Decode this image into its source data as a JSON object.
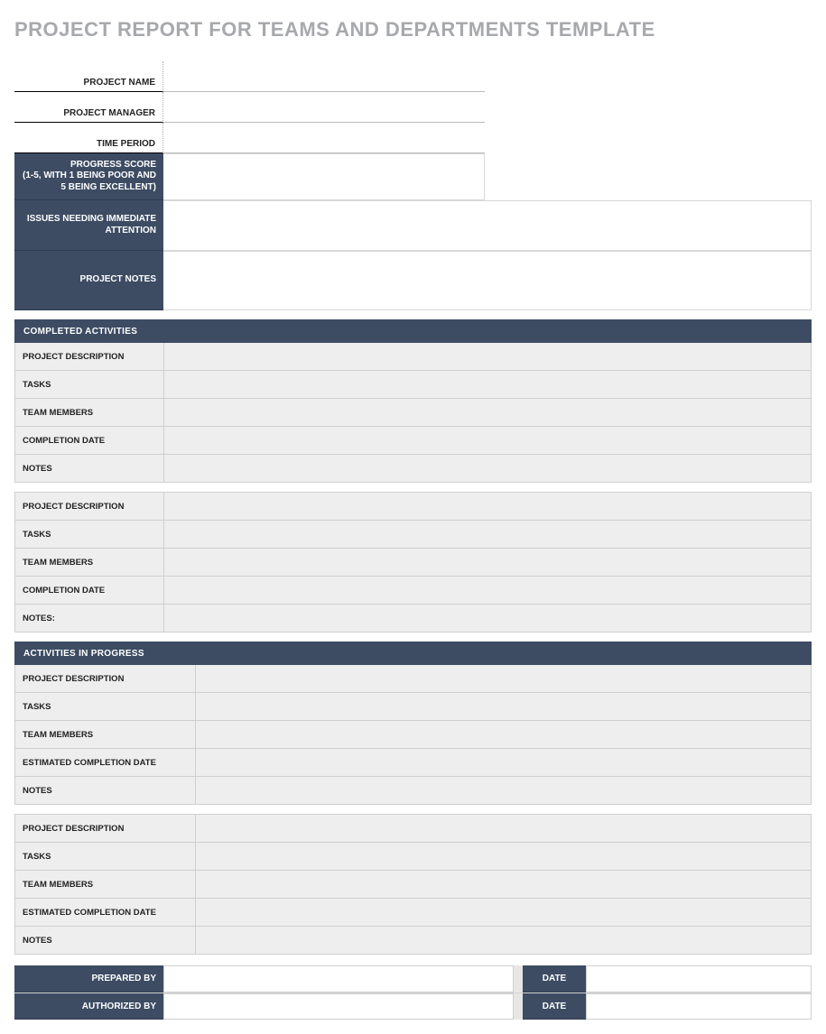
{
  "title": "PROJECT REPORT FOR TEAMS AND DEPARTMENTS TEMPLATE",
  "meta": {
    "project_name_label": "PROJECT NAME",
    "project_name_value": "",
    "project_manager_label": "PROJECT MANAGER",
    "project_manager_value": "",
    "time_period_label": "TIME PERIOD",
    "time_period_value": ""
  },
  "overview": {
    "progress_score_label": "PROGRESS SCORE\n(1-5, WITH 1 BEING POOR AND 5 BEING EXCELLENT)",
    "progress_score_value": "",
    "issues_label": "ISSUES NEEDING IMMEDIATE ATTENTION",
    "issues_value": "",
    "notes_label": "PROJECT NOTES",
    "notes_value": ""
  },
  "completed": {
    "header": "COMPLETED ACTIVITIES",
    "groups": [
      {
        "rows": [
          {
            "label": "PROJECT DESCRIPTION",
            "value": ""
          },
          {
            "label": "TASKS",
            "value": ""
          },
          {
            "label": "TEAM MEMBERS",
            "value": ""
          },
          {
            "label": "COMPLETION DATE",
            "value": ""
          },
          {
            "label": "NOTES",
            "value": ""
          }
        ]
      },
      {
        "rows": [
          {
            "label": "PROJECT DESCRIPTION",
            "value": ""
          },
          {
            "label": "TASKS",
            "value": ""
          },
          {
            "label": "TEAM MEMBERS",
            "value": ""
          },
          {
            "label": "COMPLETION DATE",
            "value": ""
          },
          {
            "label": "NOTES:",
            "value": ""
          }
        ]
      }
    ]
  },
  "in_progress": {
    "header": "ACTIVITIES IN PROGRESS",
    "groups": [
      {
        "rows": [
          {
            "label": "PROJECT DESCRIPTION",
            "value": ""
          },
          {
            "label": "TASKS",
            "value": ""
          },
          {
            "label": "TEAM MEMBERS",
            "value": ""
          },
          {
            "label": "ESTIMATED COMPLETION DATE",
            "value": ""
          },
          {
            "label": "NOTES",
            "value": ""
          }
        ]
      },
      {
        "rows": [
          {
            "label": "PROJECT DESCRIPTION",
            "value": ""
          },
          {
            "label": "TASKS",
            "value": ""
          },
          {
            "label": "TEAM MEMBERS",
            "value": ""
          },
          {
            "label": "ESTIMATED COMPLETION DATE",
            "value": ""
          },
          {
            "label": "NOTES",
            "value": ""
          }
        ]
      }
    ]
  },
  "footer": {
    "prepared_by_label": "PREPARED BY",
    "prepared_by_value": "",
    "prepared_date_label": "DATE",
    "prepared_date_value": "",
    "authorized_by_label": "AUTHORIZED BY",
    "authorized_by_value": "",
    "authorized_date_label": "DATE",
    "authorized_date_value": ""
  }
}
